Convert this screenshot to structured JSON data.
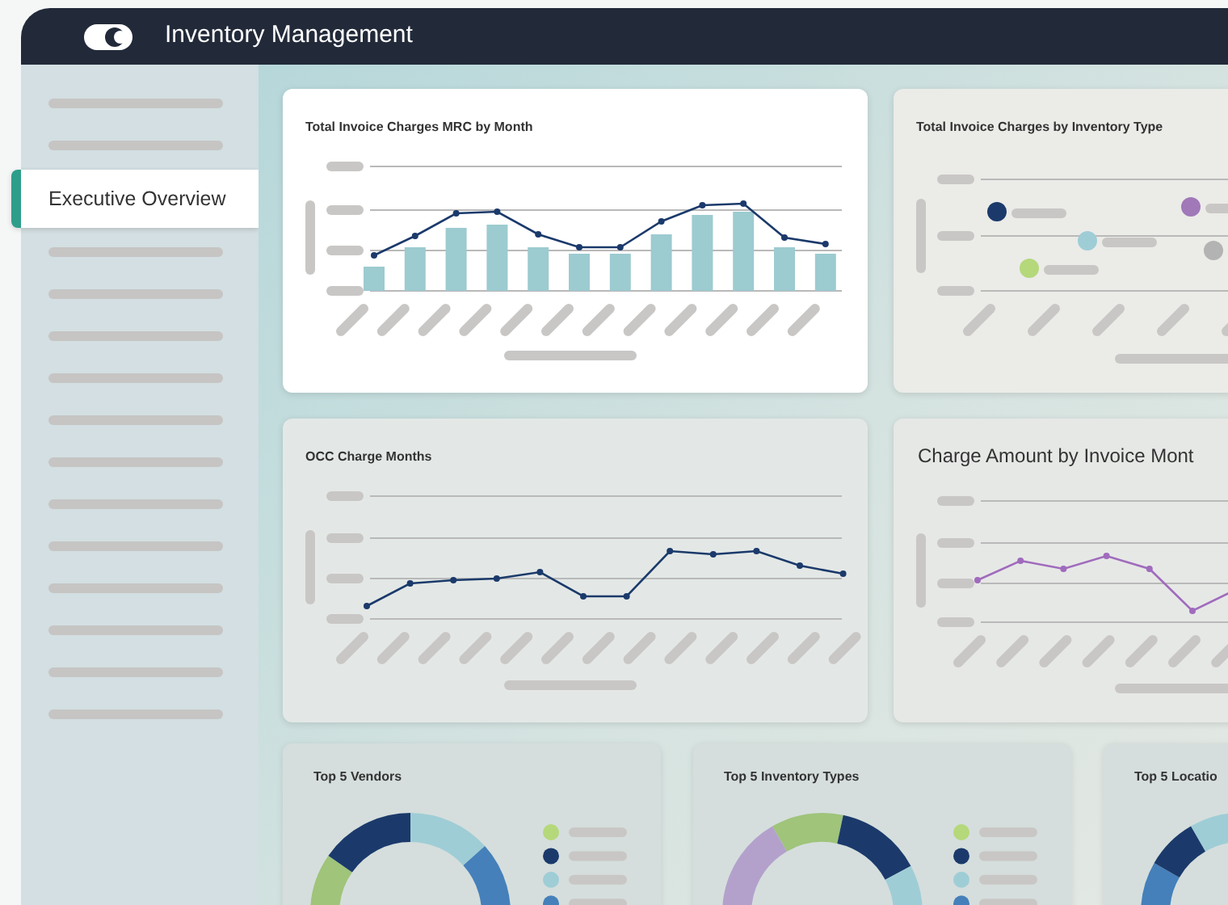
{
  "header": {
    "title": "Inventory Management"
  },
  "sidebar": {
    "items": [
      {
        "label": "Executive Overview",
        "selected": true
      }
    ]
  },
  "card_rows": [
    {
      "cards": [
        {
          "kind": "bar_line",
          "title": "Total Invoice Charges MRC by Month"
        },
        {
          "kind": "dots",
          "title": "Total Invoice Charges by Inventory Type"
        }
      ]
    },
    {
      "cards": [
        {
          "kind": "line",
          "title": "OCC Charge Months"
        },
        {
          "kind": "line_large",
          "title": "Charge Amount by Invoice Mont"
        }
      ]
    }
  ],
  "donut_cards": [
    {
      "kind": "vendors",
      "title": "Top 5 Vendors"
    },
    {
      "kind": "types",
      "title": "Top 5 Inventory Types"
    },
    {
      "kind": "locations",
      "title": "Top 5 Locatio"
    }
  ]
}
